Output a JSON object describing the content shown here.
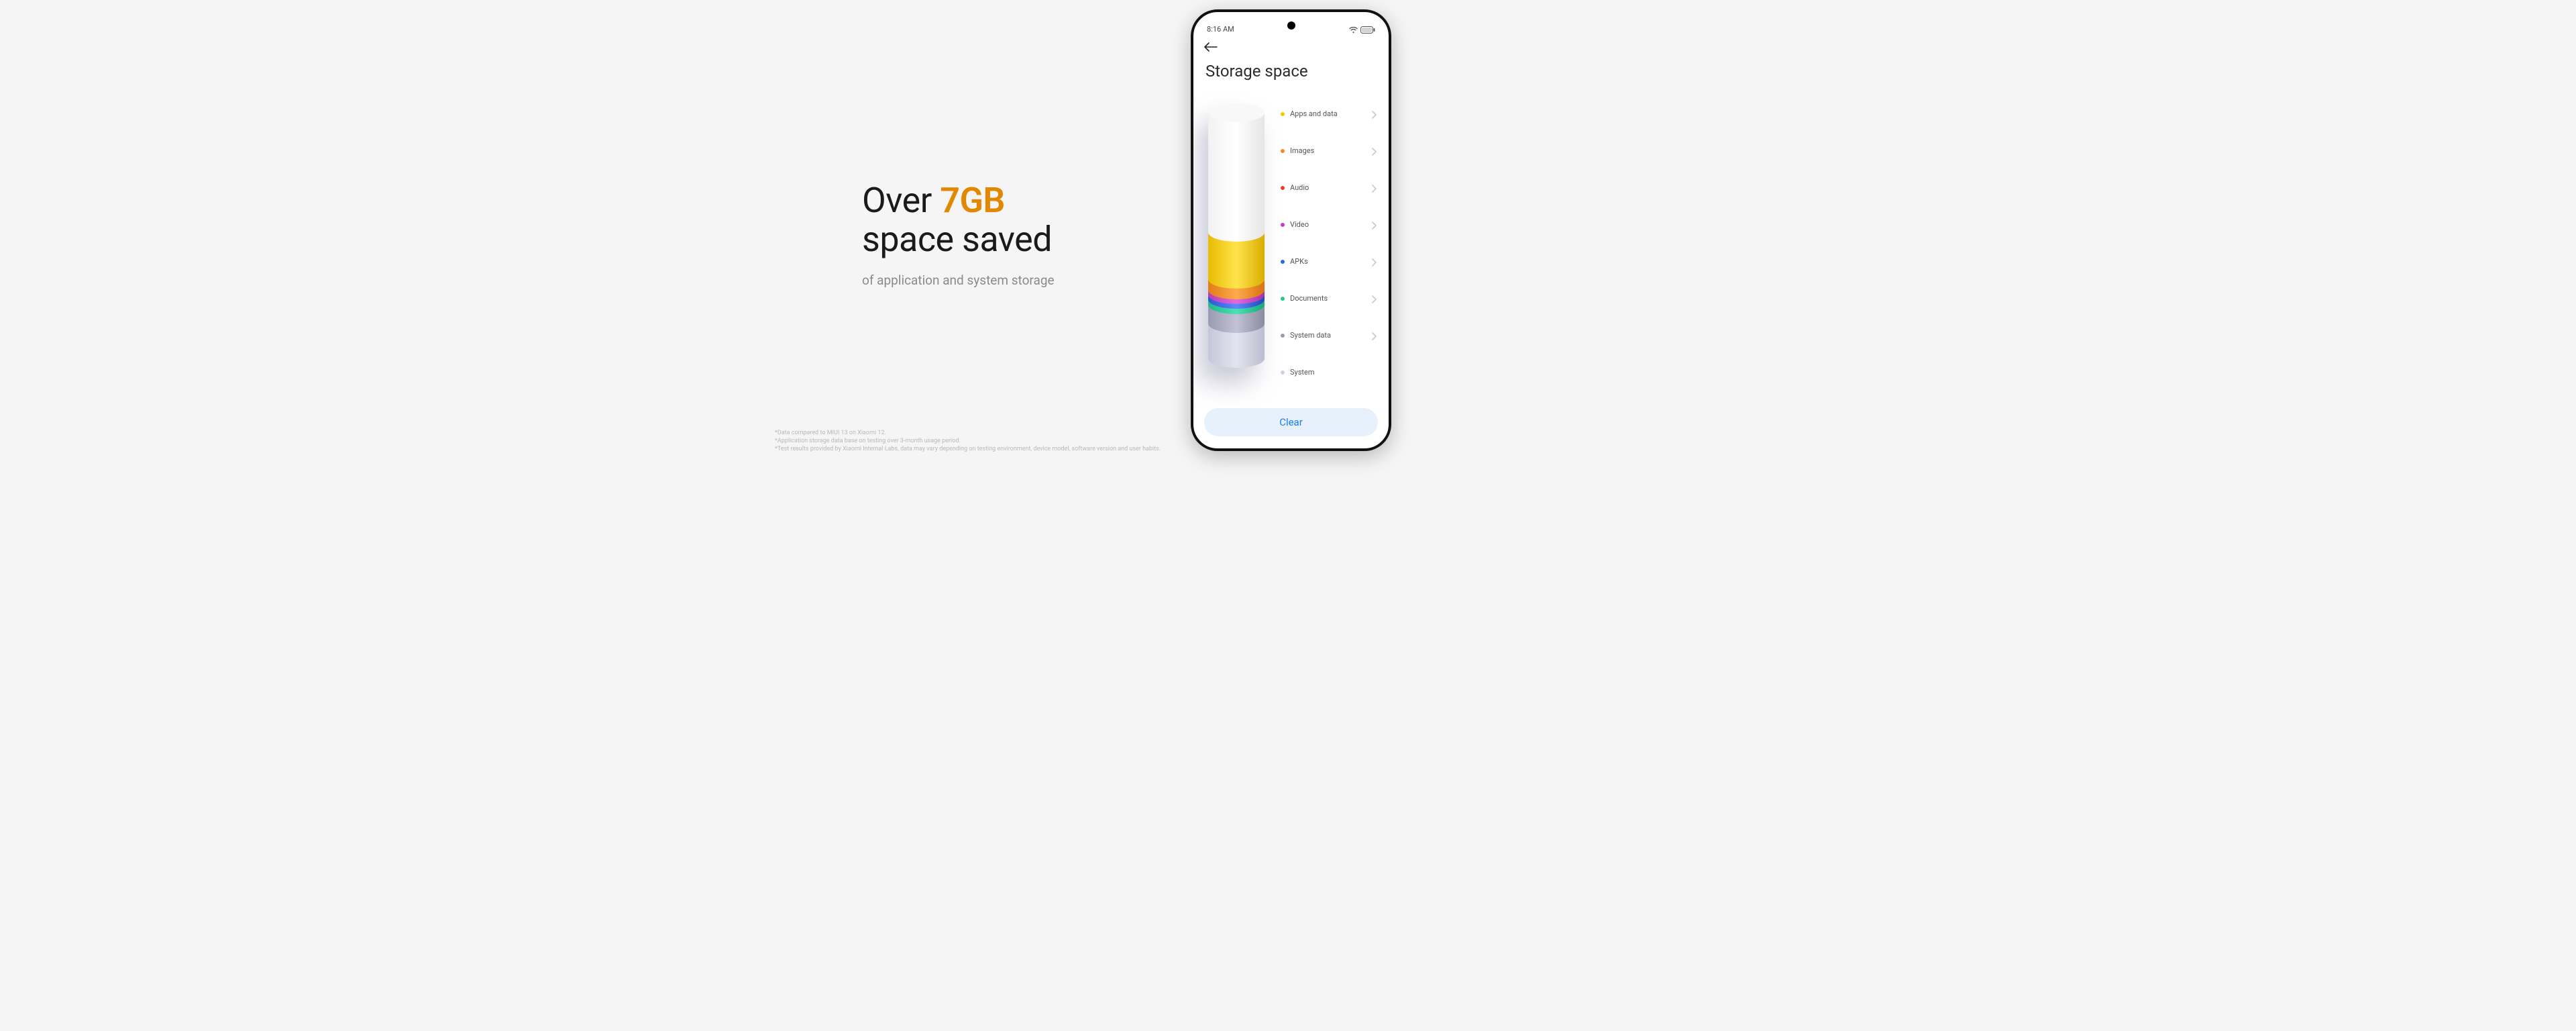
{
  "marketing": {
    "headline_pre": "Over ",
    "headline_accent": "7GB",
    "headline_post": "space saved",
    "subline": "of application and system storage",
    "footnotes": [
      "*Data compared to MIUI 13 on Xiaomi 12.",
      "*Application storage data base on testing over 3-month usage period.",
      "*Test results provided by Xiaomi Internal Labs, data may vary depending on testing environment, device model, software version and user habits."
    ]
  },
  "phone": {
    "status_time": "8:16 AM",
    "page_title": "Storage space",
    "clear_label": "Clear",
    "legend": [
      {
        "label": "Apps and data",
        "color": "#f3c900",
        "chevron": true
      },
      {
        "label": "Images",
        "color": "#f58a1f",
        "chevron": true
      },
      {
        "label": "Audio",
        "color": "#ef3a3a",
        "chevron": true
      },
      {
        "label": "Video",
        "color": "#c63acb",
        "chevron": true
      },
      {
        "label": "APKs",
        "color": "#2a68e6",
        "chevron": true
      },
      {
        "label": "Documents",
        "color": "#28c59a",
        "chevron": true
      },
      {
        "label": "System data",
        "color": "#9c9caf",
        "chevron": true
      },
      {
        "label": "System",
        "color": "#cfcfe0",
        "chevron": false
      }
    ]
  },
  "colors": {
    "accent_orange": "#e28800",
    "button_blue": "#1a7af0"
  }
}
